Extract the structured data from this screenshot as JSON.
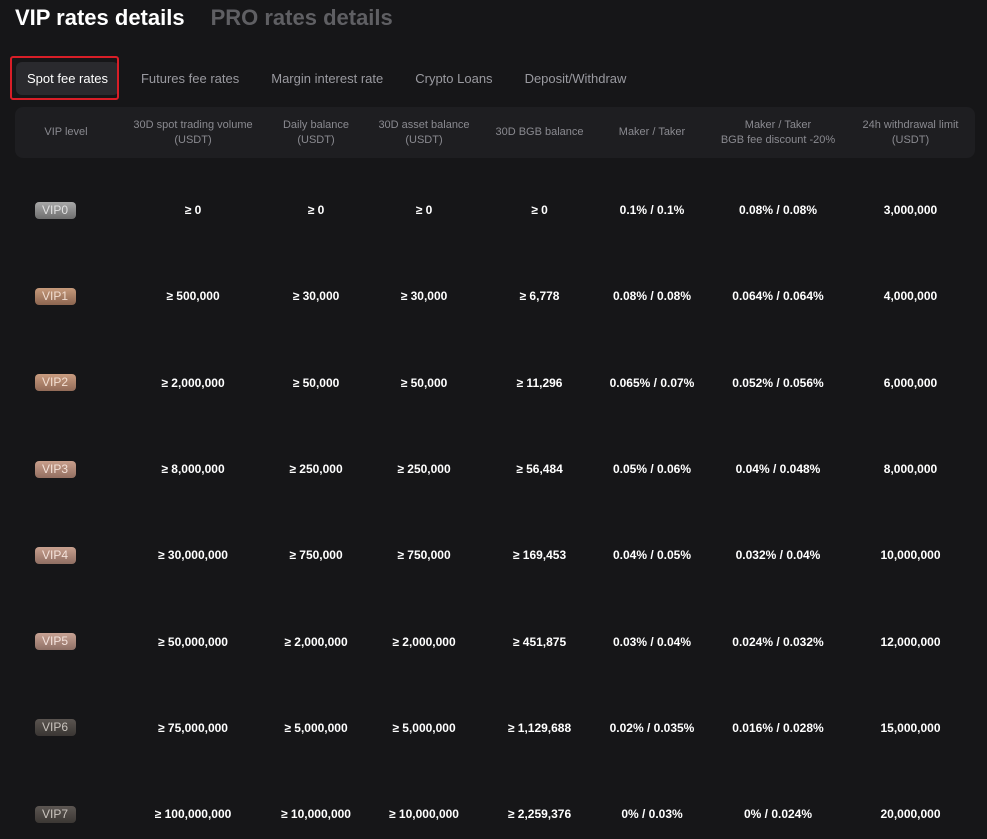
{
  "titles": {
    "vip": "VIP rates details",
    "pro": "PRO rates details"
  },
  "subtabs": [
    "Spot fee rates",
    "Futures fee rates",
    "Margin interest rate",
    "Crypto Loans",
    "Deposit/Withdraw"
  ],
  "table": {
    "headers": [
      "VIP level",
      "30D spot trading volume\n(USDT)",
      "Daily balance\n(USDT)",
      "30D asset balance\n(USDT)",
      "30D BGB balance",
      "Maker / Taker",
      "Maker / Taker\nBGB fee discount -20%",
      "24h withdrawal limit\n(USDT)"
    ],
    "rows": [
      [
        "VIP0",
        "≥ 0",
        "≥ 0",
        "≥ 0",
        "≥ 0",
        "0.1% / 0.1%",
        "0.08% / 0.08%",
        "3,000,000"
      ],
      [
        "VIP1",
        "≥ 500,000",
        "≥ 30,000",
        "≥ 30,000",
        "≥ 6,778",
        "0.08% / 0.08%",
        "0.064% / 0.064%",
        "4,000,000"
      ],
      [
        "VIP2",
        "≥ 2,000,000",
        "≥ 50,000",
        "≥ 50,000",
        "≥ 11,296",
        "0.065% / 0.07%",
        "0.052% / 0.056%",
        "6,000,000"
      ],
      [
        "VIP3",
        "≥ 8,000,000",
        "≥ 250,000",
        "≥ 250,000",
        "≥ 56,484",
        "0.05% / 0.06%",
        "0.04% / 0.048%",
        "8,000,000"
      ],
      [
        "VIP4",
        "≥ 30,000,000",
        "≥ 750,000",
        "≥ 750,000",
        "≥ 169,453",
        "0.04% / 0.05%",
        "0.032% / 0.04%",
        "10,000,000"
      ],
      [
        "VIP5",
        "≥ 50,000,000",
        "≥ 2,000,000",
        "≥ 2,000,000",
        "≥ 451,875",
        "0.03% / 0.04%",
        "0.024% / 0.032%",
        "12,000,000"
      ],
      [
        "VIP6",
        "≥ 75,000,000",
        "≥ 5,000,000",
        "≥ 5,000,000",
        "≥ 1,129,688",
        "0.02% / 0.035%",
        "0.016% / 0.028%",
        "15,000,000"
      ],
      [
        "VIP7",
        "≥ 100,000,000",
        "≥ 10,000,000",
        "≥ 10,000,000",
        "≥ 2,259,376",
        "0% / 0.03%",
        "0% / 0.024%",
        "20,000,000"
      ]
    ]
  },
  "colors": {
    "background": "#161618",
    "header_bg": "#1e1e21",
    "active_tab_bg": "#2a2a2e",
    "highlight_border": "#d81e27"
  }
}
